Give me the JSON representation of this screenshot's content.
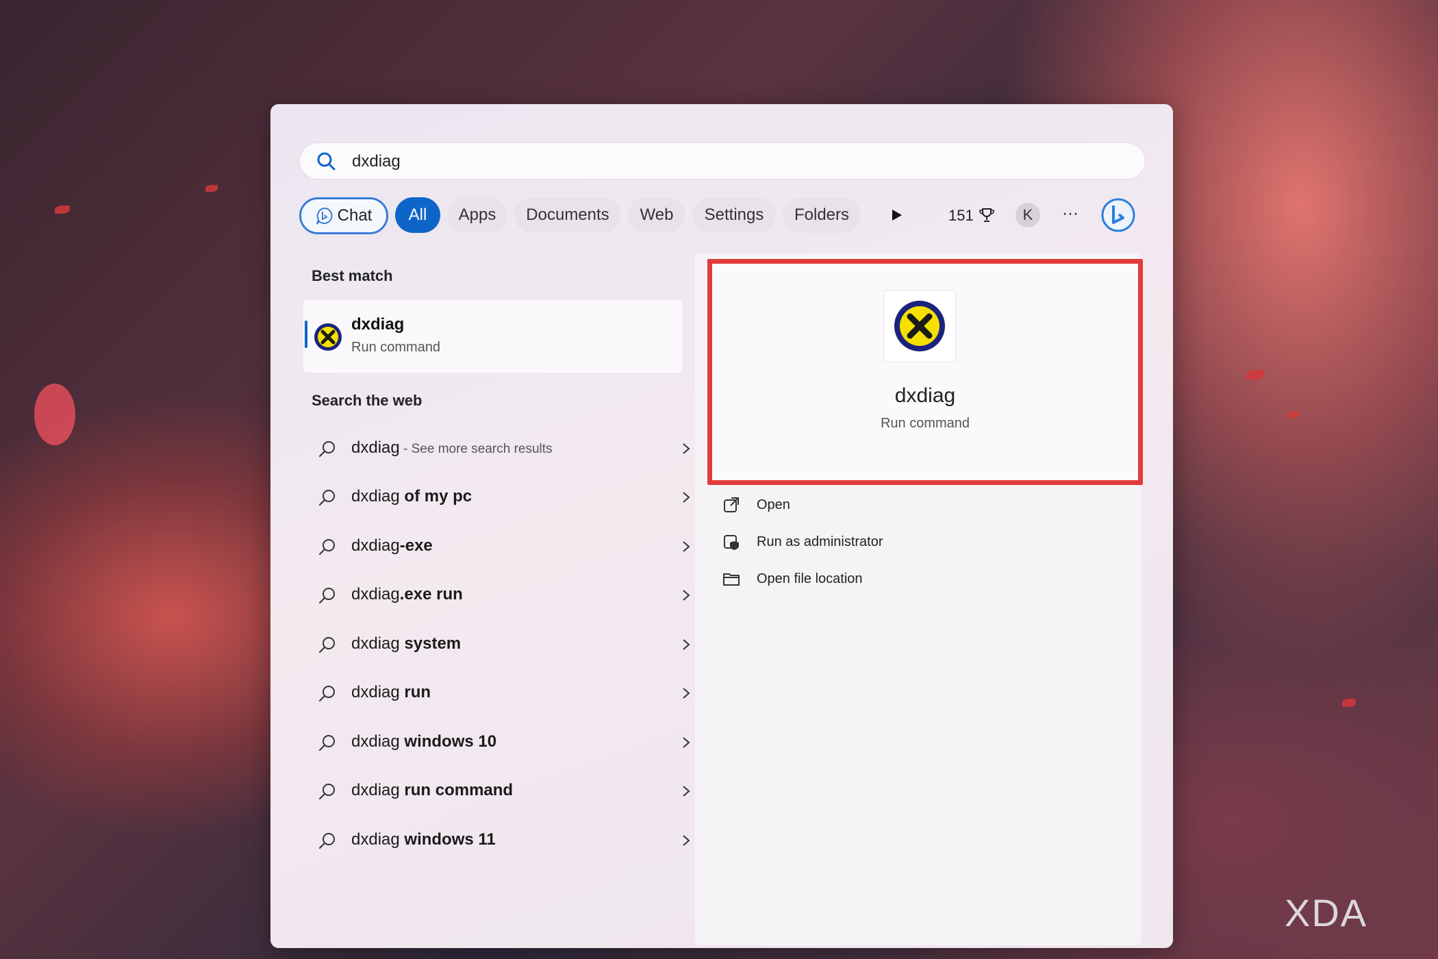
{
  "search": {
    "value": "dxdiag"
  },
  "filters": {
    "chat": "Chat",
    "all": "All",
    "apps": "Apps",
    "documents": "Documents",
    "web": "Web",
    "settings": "Settings",
    "folders": "Folders",
    "points": "151",
    "avatar_initial": "K",
    "more": "···"
  },
  "best_match": {
    "heading": "Best match",
    "name": "dxdiag",
    "type": "Run command"
  },
  "web_search": {
    "heading": "Search the web",
    "first": {
      "prefix": "dxdiag",
      "hint": " - See more search results"
    },
    "items": [
      {
        "prefix": "dxdiag",
        "bold": " of my pc"
      },
      {
        "prefix": "dxdiag",
        "bold": "-exe"
      },
      {
        "prefix": "dxdiag",
        "bold": ".exe run"
      },
      {
        "prefix": "dxdiag",
        "bold": " system"
      },
      {
        "prefix": "dxdiag",
        "bold": " run"
      },
      {
        "prefix": "dxdiag",
        "bold": " windows 10"
      },
      {
        "prefix": "dxdiag",
        "bold": " run command"
      },
      {
        "prefix": "dxdiag",
        "bold": " windows 11"
      }
    ]
  },
  "detail": {
    "name": "dxdiag",
    "type": "Run command",
    "actions": {
      "open": "Open",
      "run_admin": "Run as administrator",
      "open_location": "Open file location"
    }
  },
  "watermark": "XDA",
  "colors": {
    "accent": "#0d65c9",
    "highlight": "#e23b3b"
  }
}
